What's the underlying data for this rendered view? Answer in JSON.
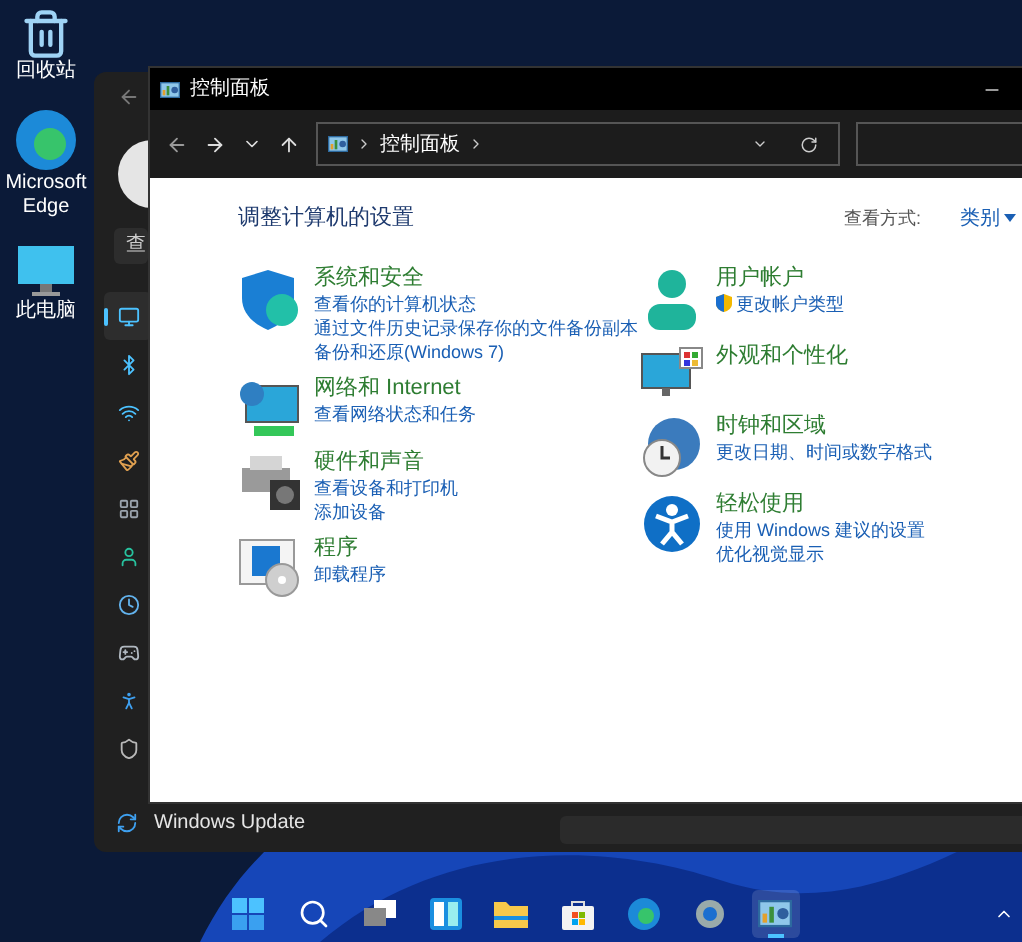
{
  "desktop_icons": [
    {
      "label": "回收站"
    },
    {
      "label": "Microsoft Edge"
    },
    {
      "label": "此电脑"
    }
  ],
  "settings_window": {
    "search_field": {
      "value": "查"
    },
    "sidebar_items": [
      {
        "selected": true
      },
      {
        "selected": false
      },
      {
        "selected": false
      },
      {
        "selected": false
      },
      {
        "selected": false
      },
      {
        "selected": false
      },
      {
        "selected": false
      },
      {
        "selected": false
      },
      {
        "selected": false
      },
      {
        "selected": false
      }
    ],
    "footer_item": {
      "label": "Windows Update"
    }
  },
  "control_panel": {
    "title": "控制面板",
    "breadcrumbs": [
      "控制面板"
    ],
    "heading": "调整计算机的设置",
    "view_by": {
      "label": "查看方式:",
      "value": "类别"
    },
    "columns": [
      [
        {
          "title": "系统和安全",
          "links": [
            {
              "text": "查看你的计算机状态",
              "kind": "plain"
            },
            {
              "text": "通过文件历史记录保存你的文件备份副本",
              "kind": "plain"
            },
            {
              "text": "备份和还原(Windows 7)",
              "kind": "plain"
            }
          ]
        },
        {
          "title": "网络和 Internet",
          "links": [
            {
              "text": "查看网络状态和任务",
              "kind": "plain"
            }
          ]
        },
        {
          "title": "硬件和声音",
          "links": [
            {
              "text": "查看设备和打印机",
              "kind": "plain"
            },
            {
              "text": "添加设备",
              "kind": "plain"
            }
          ]
        },
        {
          "title": "程序",
          "links": [
            {
              "text": "卸载程序",
              "kind": "plain"
            }
          ]
        }
      ],
      [
        {
          "title": "用户帐户",
          "links": [
            {
              "text": "更改帐户类型",
              "kind": "admin"
            }
          ]
        },
        {
          "title": "外观和个性化"
        },
        {
          "title": "时钟和区域",
          "links": [
            {
              "text": "更改日期、时间或数字格式",
              "kind": "plain"
            }
          ]
        },
        {
          "title": "轻松使用",
          "links": [
            {
              "text": "使用 Windows 建议的设置",
              "kind": "plain"
            },
            {
              "text": "优化视觉显示",
              "kind": "plain"
            }
          ]
        }
      ]
    ]
  },
  "taskbar": [
    {
      "selected": false
    },
    {
      "selected": false
    },
    {
      "selected": false
    },
    {
      "selected": false
    },
    {
      "selected": false
    },
    {
      "selected": false
    },
    {
      "selected": false
    },
    {
      "selected": false
    },
    {
      "selected": true
    }
  ]
}
